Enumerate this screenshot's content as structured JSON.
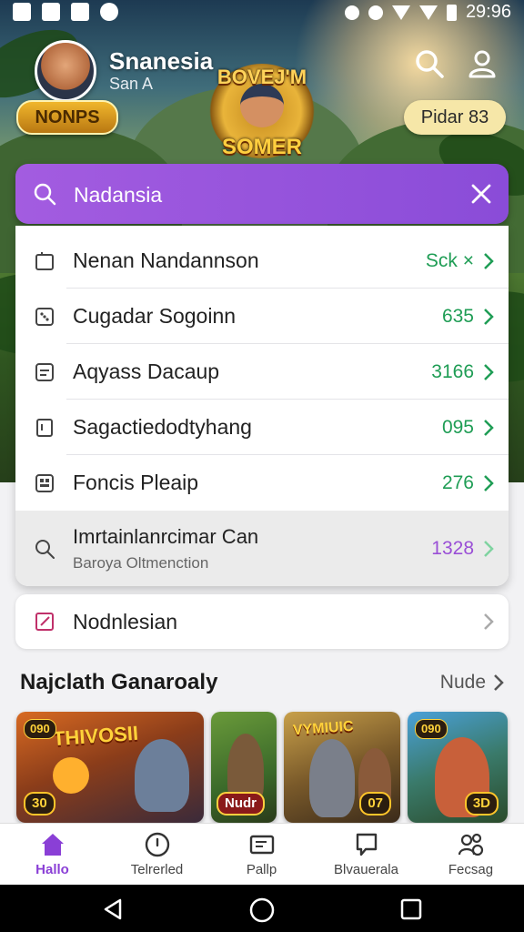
{
  "status_bar": {
    "time": "29:96"
  },
  "header": {
    "username": "Snanesia",
    "subname": "San A",
    "bonus_badge": "NONPS",
    "logo_top": "BOVEJ'M",
    "logo_bottom": "SOMER",
    "promo_pill": "Pidar 83",
    "icons": [
      "search-icon",
      "profile-icon"
    ]
  },
  "search": {
    "value": "Nadansia",
    "icons": [
      "search-icon",
      "close-icon"
    ]
  },
  "results": [
    {
      "label": "Nenan Nandannson",
      "value": "Sck ×",
      "icon": "battery-icon"
    },
    {
      "label": "Cugadar Sogoinn",
      "value": "635",
      "icon": "dice-icon"
    },
    {
      "label": "Aqyass Dacaup",
      "value": "3166",
      "icon": "card-icon"
    },
    {
      "label": "Sagactiedodtyhang",
      "value": "095",
      "icon": "document-icon"
    },
    {
      "label": "Foncis Pleaip",
      "value": "276",
      "icon": "grid-icon"
    }
  ],
  "highlight_result": {
    "label": "Imrtainlanrcimar Can",
    "sublabel": "Baroya Oltmenction",
    "value": "1328",
    "icon": "search-icon"
  },
  "extra_card": {
    "label": "Nodnlesian",
    "icon": "edit-icon"
  },
  "section": {
    "title": "Najclath Ganaroaly",
    "more": "Nude"
  },
  "games": [
    {
      "title": "THIVOSII",
      "tag": "090",
      "score": "30"
    },
    {
      "title": "",
      "tag": "",
      "score": "Nudr"
    },
    {
      "title": "VYMIUIC",
      "tag": "",
      "score": "07"
    },
    {
      "title": "",
      "tag": "090",
      "score": "3D"
    }
  ],
  "bottom_nav": [
    {
      "label": "Hallo",
      "icon": "home-icon",
      "active": true
    },
    {
      "label": "Telrerled",
      "icon": "compass-icon",
      "active": false
    },
    {
      "label": "Pallp",
      "icon": "ticket-icon",
      "active": false
    },
    {
      "label": "Blvauerala",
      "icon": "chat-icon",
      "active": false
    },
    {
      "label": "Fecsag",
      "icon": "people-icon",
      "active": false
    }
  ],
  "colors": {
    "accent": "#8a4cd8",
    "value_green": "#1f9d55",
    "value_purple": "#9a4fd6",
    "gold": "#ffd23a"
  }
}
